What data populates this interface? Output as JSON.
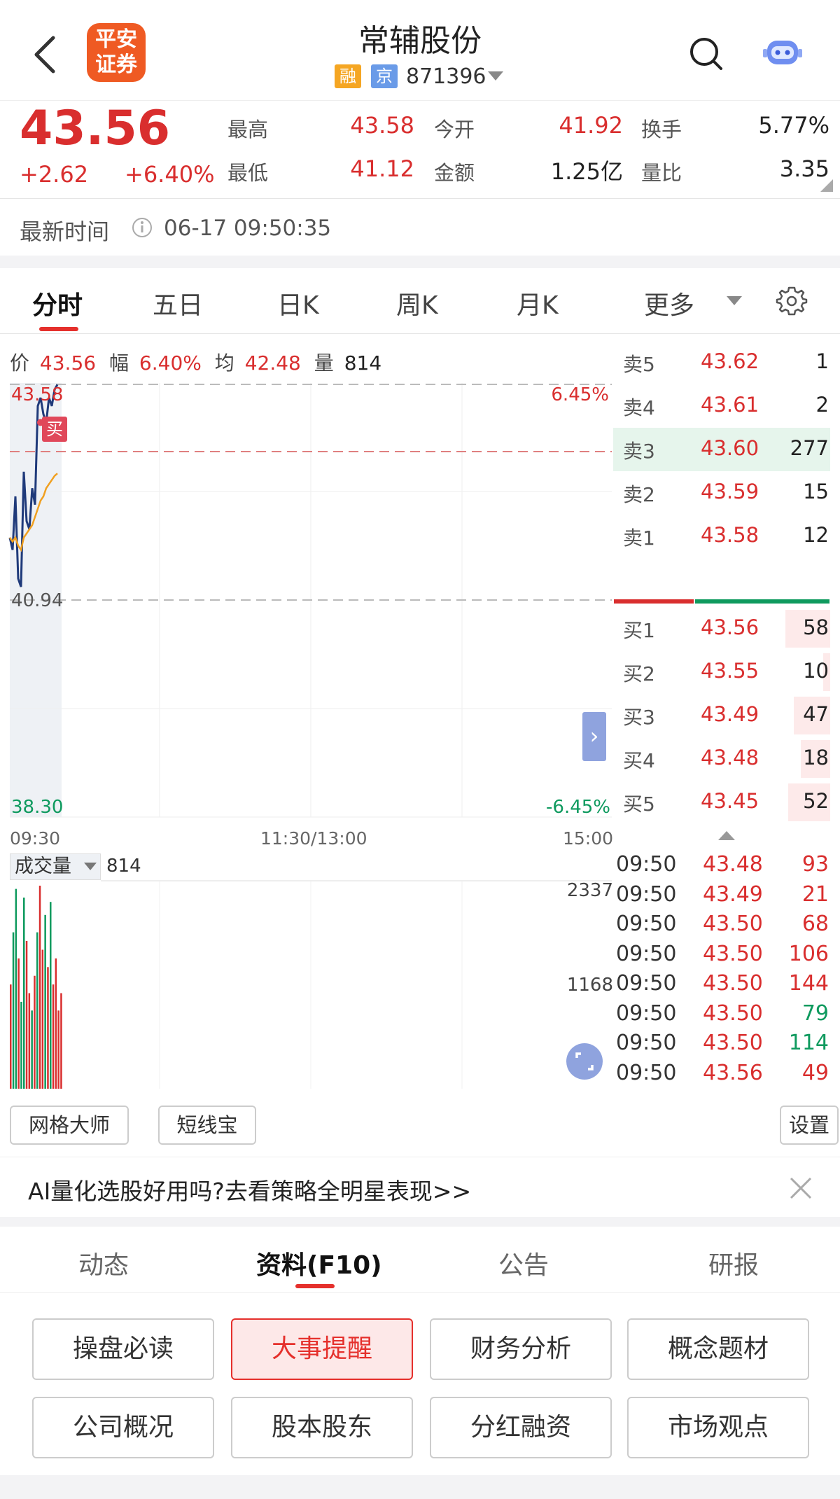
{
  "header": {
    "logo_text": "平安证券",
    "title": "常辅股份",
    "tag_margin": "融",
    "tag_exchange": "京",
    "code": "871396"
  },
  "quote": {
    "price": "43.56",
    "change": "+2.62",
    "change_pct": "+6.40%",
    "high_label": "最高",
    "high": "43.58",
    "low_label": "最低",
    "low": "41.12",
    "open_label": "今开",
    "open": "41.92",
    "amount_label": "金额",
    "amount": "1.25亿",
    "turnover_label": "换手",
    "turnover": "5.77%",
    "vol_ratio_label": "量比",
    "vol_ratio": "3.35"
  },
  "time_bar": {
    "label": "最新时间",
    "value": "06-17 09:50:35"
  },
  "period_tabs": [
    {
      "label": "分时",
      "active": true
    },
    {
      "label": "五日"
    },
    {
      "label": "日K"
    },
    {
      "label": "周K"
    },
    {
      "label": "月K"
    },
    {
      "label": "更多"
    }
  ],
  "info_line": {
    "price_label": "价",
    "price": "43.56",
    "amp_label": "幅",
    "amp": "6.40%",
    "avg_label": "均",
    "avg": "42.48",
    "vol_label": "量",
    "vol": "814"
  },
  "chart_axes": {
    "y_top": "43.58",
    "y_mid": "40.94",
    "y_bottom": "38.30",
    "pct_top": "6.45%",
    "pct_bottom": "-6.45%",
    "x_start": "09:30",
    "x_mid": "11:30/13:00",
    "x_end": "15:00",
    "buy_marker": "买"
  },
  "chart_data": {
    "type": "line",
    "x_range": [
      "09:30",
      "15:00"
    ],
    "ylim": [
      38.3,
      43.58
    ],
    "reference_price": 40.94,
    "series": [
      {
        "name": "价",
        "values": [
          41.7,
          41.55,
          42.2,
          41.2,
          41.1,
          42.5,
          41.9,
          41.8,
          42.3,
          42.1,
          43.3,
          43.4,
          43.2,
          43.1,
          43.4,
          43.3,
          43.5,
          43.56
        ]
      },
      {
        "name": "均",
        "values": [
          41.7,
          41.65,
          41.7,
          41.6,
          41.55,
          41.7,
          41.75,
          41.8,
          41.85,
          41.95,
          42.05,
          42.15,
          42.2,
          42.3,
          42.35,
          42.4,
          42.45,
          42.48
        ]
      }
    ],
    "volume": {
      "label": "成交量",
      "current": "814",
      "max_label": "2337",
      "mid_label": "1168",
      "ymax": 2337,
      "bars": [
        {
          "v": 1200,
          "c": "red"
        },
        {
          "v": 1800,
          "c": "green"
        },
        {
          "v": 2300,
          "c": "green"
        },
        {
          "v": 1500,
          "c": "red"
        },
        {
          "v": 1000,
          "c": "green"
        },
        {
          "v": 2200,
          "c": "green"
        },
        {
          "v": 1700,
          "c": "red"
        },
        {
          "v": 1100,
          "c": "red"
        },
        {
          "v": 900,
          "c": "green"
        },
        {
          "v": 1300,
          "c": "red"
        },
        {
          "v": 1800,
          "c": "green"
        },
        {
          "v": 2337,
          "c": "red"
        },
        {
          "v": 1600,
          "c": "red"
        },
        {
          "v": 2000,
          "c": "green"
        },
        {
          "v": 1400,
          "c": "red"
        },
        {
          "v": 2150,
          "c": "green"
        },
        {
          "v": 1200,
          "c": "red"
        },
        {
          "v": 1500,
          "c": "red"
        },
        {
          "v": 900,
          "c": "red"
        },
        {
          "v": 1100,
          "c": "red"
        }
      ]
    }
  },
  "order_book": {
    "asks": [
      {
        "label": "卖5",
        "price": "43.62",
        "vol": "1"
      },
      {
        "label": "卖4",
        "price": "43.61",
        "vol": "2"
      },
      {
        "label": "卖3",
        "price": "43.60",
        "vol": "277"
      },
      {
        "label": "卖2",
        "price": "43.59",
        "vol": "15"
      },
      {
        "label": "卖1",
        "price": "43.58",
        "vol": "12"
      }
    ],
    "bids": [
      {
        "label": "买1",
        "price": "43.56",
        "vol": "58"
      },
      {
        "label": "买2",
        "price": "43.55",
        "vol": "10"
      },
      {
        "label": "买3",
        "price": "43.49",
        "vol": "47"
      },
      {
        "label": "买4",
        "price": "43.48",
        "vol": "18"
      },
      {
        "label": "买5",
        "price": "43.45",
        "vol": "52"
      }
    ]
  },
  "ticks": [
    {
      "time": "09:50",
      "price": "43.48",
      "vol": "93",
      "dir": "red"
    },
    {
      "time": "09:50",
      "price": "43.49",
      "vol": "21",
      "dir": "red"
    },
    {
      "time": "09:50",
      "price": "43.50",
      "vol": "68",
      "dir": "red"
    },
    {
      "time": "09:50",
      "price": "43.50",
      "vol": "106",
      "dir": "red"
    },
    {
      "time": "09:50",
      "price": "43.50",
      "vol": "144",
      "dir": "red"
    },
    {
      "time": "09:50",
      "price": "43.50",
      "vol": "79",
      "dir": "green"
    },
    {
      "time": "09:50",
      "price": "43.50",
      "vol": "114",
      "dir": "green"
    },
    {
      "time": "09:50",
      "price": "43.56",
      "vol": "49",
      "dir": "red"
    }
  ],
  "tools": {
    "grid_master": "网格大师",
    "short_bao": "短线宝",
    "settings": "设置"
  },
  "ad": {
    "text": "AI量化选股好用吗?去看策略全明星表现>>"
  },
  "bottom_tabs": [
    {
      "label": "动态"
    },
    {
      "label": "资料(F10)",
      "active": true
    },
    {
      "label": "公告"
    },
    {
      "label": "研报"
    }
  ],
  "f10_buttons": [
    {
      "label": "操盘必读"
    },
    {
      "label": "大事提醒",
      "active": true
    },
    {
      "label": "财务分析"
    },
    {
      "label": "概念题材"
    },
    {
      "label": "公司概况"
    },
    {
      "label": "股本股东"
    },
    {
      "label": "分红融资"
    },
    {
      "label": "市场观点"
    }
  ],
  "colors": {
    "up": "#d92e2e",
    "down": "#0e9a5e",
    "price_line": "#1f3a7a",
    "avg_line": "#f0a020",
    "accent": "#ef5a23"
  }
}
